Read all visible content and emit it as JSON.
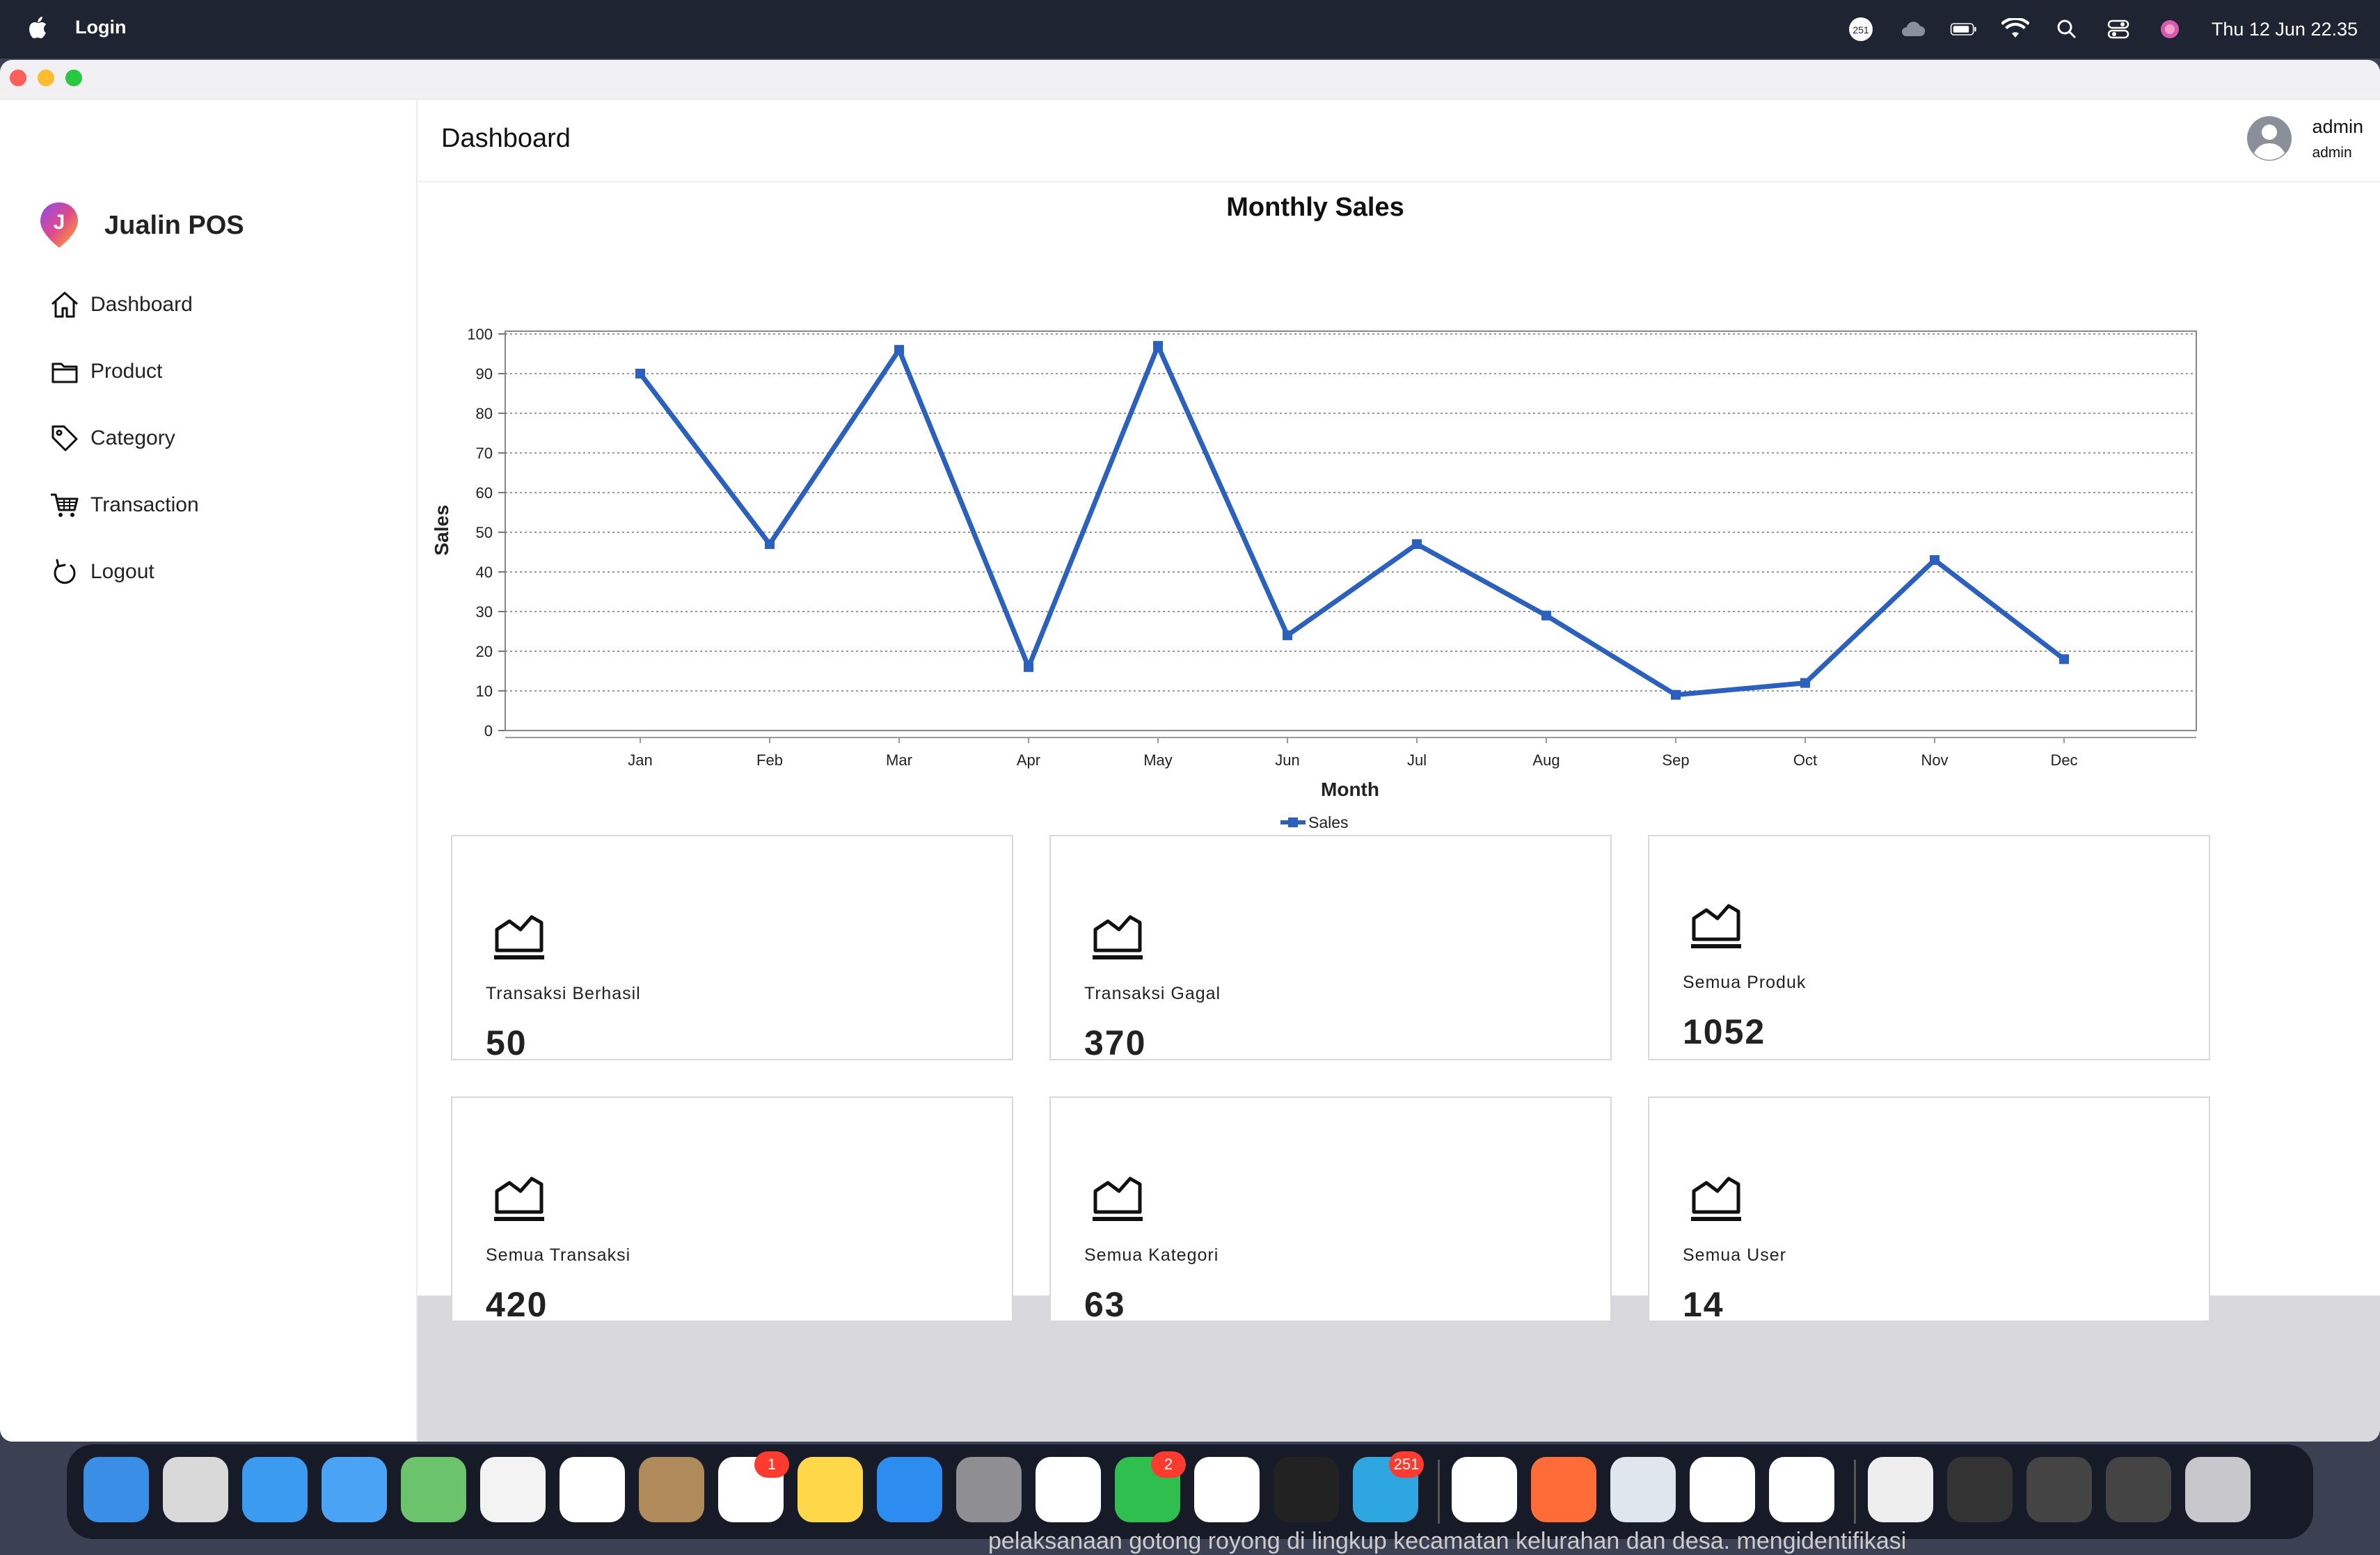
{
  "menubar": {
    "app_name": "Login",
    "badge_count": "251",
    "clock": "Thu 12 Jun  22.35"
  },
  "sidebar": {
    "brand": "Jualin POS",
    "items": [
      {
        "label": "Dashboard",
        "icon": "home-icon"
      },
      {
        "label": "Product",
        "icon": "folder-icon"
      },
      {
        "label": "Category",
        "icon": "tag-icon"
      },
      {
        "label": "Transaction",
        "icon": "cart-icon"
      },
      {
        "label": "Logout",
        "icon": "logout-icon"
      }
    ]
  },
  "header": {
    "title": "Dashboard",
    "user_name": "admin",
    "user_role": "admin"
  },
  "chart_data": {
    "type": "line",
    "title": "Monthly Sales",
    "xlabel": "Month",
    "ylabel": "Sales",
    "ylim": [
      0,
      100
    ],
    "yticks": [
      0,
      10,
      20,
      30,
      40,
      50,
      60,
      70,
      80,
      90,
      100
    ],
    "categories": [
      "Jan",
      "Feb",
      "Mar",
      "Apr",
      "May",
      "Jun",
      "Jul",
      "Aug",
      "Sep",
      "Oct",
      "Nov",
      "Dec"
    ],
    "series": [
      {
        "name": "Sales",
        "values": [
          90,
          47,
          96,
          16,
          97,
          24,
          47,
          29,
          9,
          12,
          43,
          18
        ]
      }
    ],
    "grid": true,
    "legend": "bottom-center",
    "color": "#2a60c0"
  },
  "cards": [
    {
      "label": "Transaksi Berhasil",
      "value": "50"
    },
    {
      "label": "Transaksi Gagal",
      "value": "370"
    },
    {
      "label": "Semua Produk",
      "value": "1052"
    },
    {
      "label": "Semua Transaksi",
      "value": "420"
    },
    {
      "label": "Semua Kategori",
      "value": "63"
    },
    {
      "label": "Semua User",
      "value": "14"
    }
  ],
  "dock": {
    "badges": {
      "reminders": "1",
      "whatsapp": "2",
      "telegram": "251"
    },
    "peek_text": "pelaksanaan gotong royong di lingkup kecamatan kelurahan dan desa. mengidentifikasi"
  }
}
